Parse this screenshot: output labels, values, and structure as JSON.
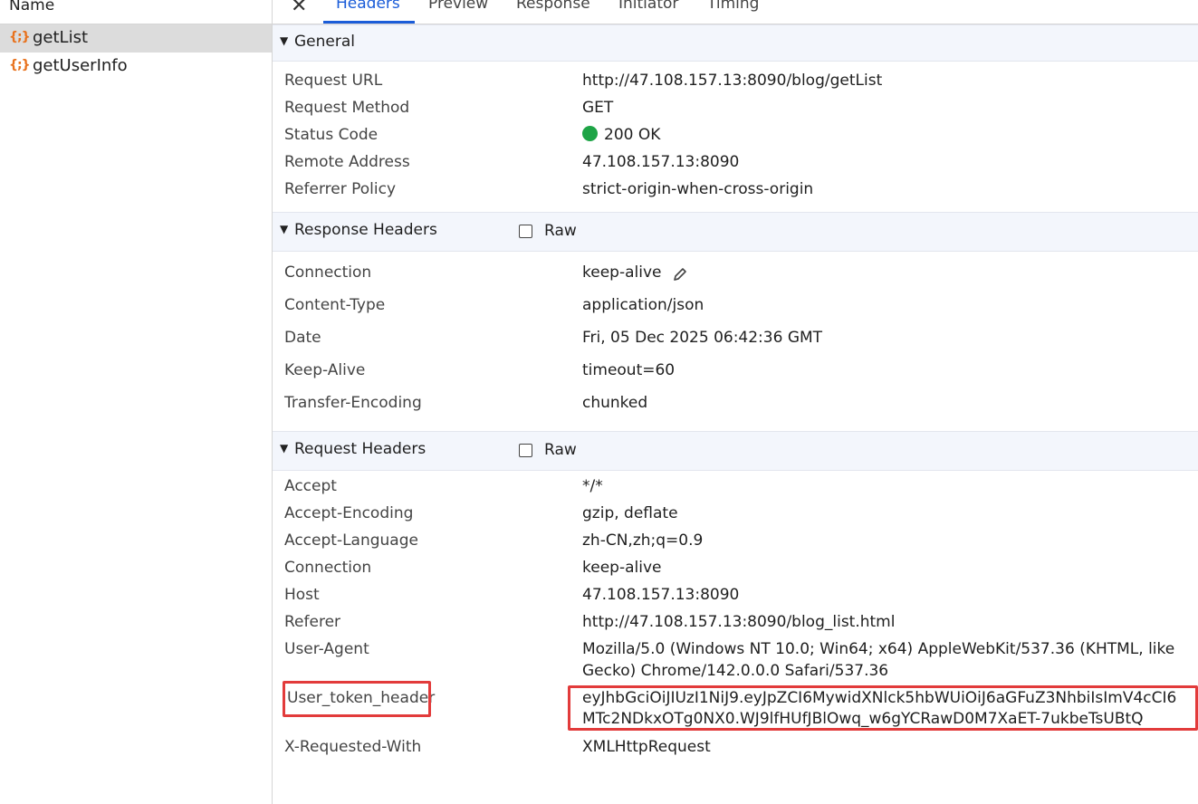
{
  "sidebar": {
    "header": "Name",
    "requests": [
      {
        "icon": "{;}",
        "name": "getList"
      },
      {
        "icon": "{;}",
        "name": "getUserInfo"
      }
    ]
  },
  "tabs": {
    "close": "✕",
    "items": [
      "Headers",
      "Preview",
      "Response",
      "Initiator",
      "Timing"
    ],
    "active": "Headers"
  },
  "general": {
    "title": "General",
    "rows": [
      {
        "key": "Request URL",
        "value": "http://47.108.157.13:8090/blog/getList"
      },
      {
        "key": "Request Method",
        "value": "GET"
      },
      {
        "key": "Status Code",
        "value": "200 OK"
      },
      {
        "key": "Remote Address",
        "value": "47.108.157.13:8090"
      },
      {
        "key": "Referrer Policy",
        "value": "strict-origin-when-cross-origin"
      }
    ]
  },
  "response_headers": {
    "title": "Response Headers",
    "raw_label": "Raw",
    "rows": [
      {
        "key": "Connection",
        "value": "keep-alive"
      },
      {
        "key": "Content-Type",
        "value": "application/json"
      },
      {
        "key": "Date",
        "value": "Fri, 05 Dec 2025 06:42:36 GMT"
      },
      {
        "key": "Keep-Alive",
        "value": "timeout=60"
      },
      {
        "key": "Transfer-Encoding",
        "value": "chunked"
      }
    ]
  },
  "request_headers": {
    "title": "Request Headers",
    "raw_label": "Raw",
    "rows": [
      {
        "key": "Accept",
        "value": "*/*"
      },
      {
        "key": "Accept-Encoding",
        "value": "gzip, deflate"
      },
      {
        "key": "Accept-Language",
        "value": "zh-CN,zh;q=0.9"
      },
      {
        "key": "Connection",
        "value": "keep-alive"
      },
      {
        "key": "Host",
        "value": "47.108.157.13:8090"
      },
      {
        "key": "Referer",
        "value": "http://47.108.157.13:8090/blog_list.html"
      },
      {
        "key": "User-Agent",
        "value": "Mozilla/5.0 (Windows NT 10.0; Win64; x64) AppleWebKit/537.36 (KHTML, like",
        "value2": "Gecko) Chrome/142.0.0.0 Safari/537.36"
      },
      {
        "key": "User_token_header",
        "value": "eyJhbGciOiJIUzI1NiJ9.eyJpZCI6MywidXNlck5hbWUiOiJ6aGFuZ3NhbiIsImV4cCI6",
        "value2": "MTc2NDkxOTg0NX0.WJ9lfHUfJBlOwq_w6gYCRawD0M7XaET-7ukbeTsUBtQ"
      },
      {
        "key": "X-Requested-With",
        "value": "XMLHttpRequest"
      }
    ]
  },
  "colors": {
    "accent": "#1a5cd8",
    "status_ok": "#1ea446",
    "highlight": "#e23b3b",
    "icon_orange": "#e8711c"
  }
}
